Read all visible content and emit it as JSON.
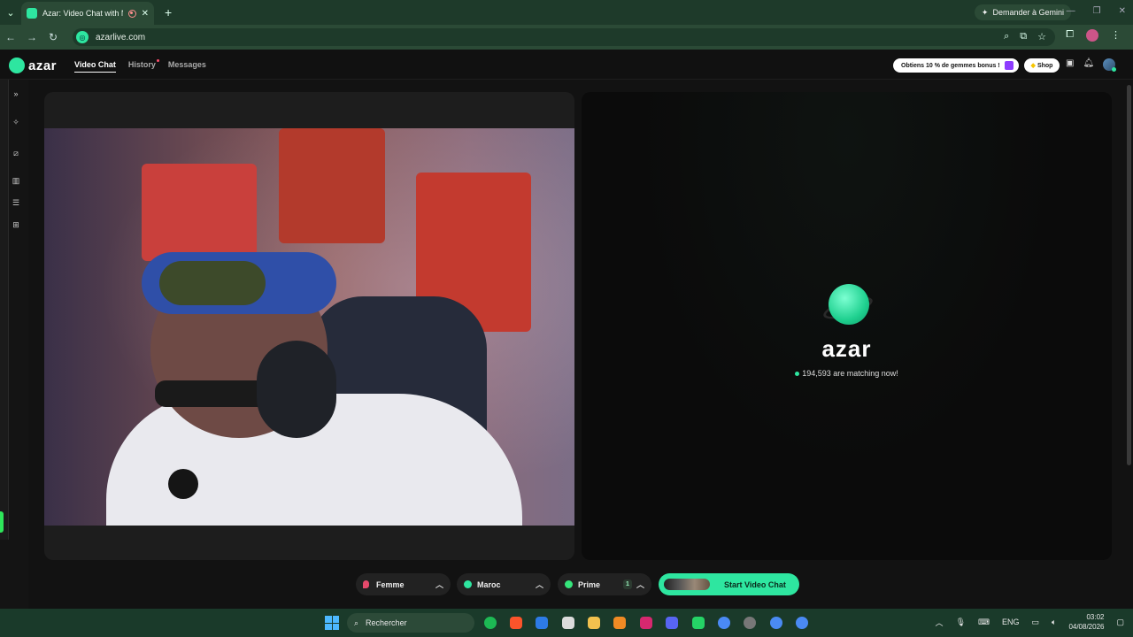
{
  "browser": {
    "tab_title": "Azar: Video Chat with New",
    "new_tab_symbol": "+",
    "close_symbol": "✕",
    "url": "azarlive.com",
    "gemini_label": "Demander à Gemini"
  },
  "app": {
    "logo_text": "azar",
    "nav": {
      "video_chat": "Video Chat",
      "history": "History",
      "messages": "Messages"
    },
    "promo_text": "Obtiens 10 % de gemmes bonus !",
    "shop_label": "Shop"
  },
  "right_panel": {
    "brand": "azar",
    "matching_text": "194,593 are matching now!"
  },
  "filters": {
    "gender": "Femme",
    "country": "Maroc",
    "prime": "Prime",
    "prime_badge": "1",
    "start_button": "Start Video Chat"
  },
  "taskbar": {
    "search_placeholder": "Rechercher",
    "language": "ENG",
    "time": "03:02",
    "date": "04/08/2026"
  },
  "colors": {
    "accent": "#2ee6a0",
    "browser_frame": "#2b4a36",
    "app_bg": "#121212"
  }
}
